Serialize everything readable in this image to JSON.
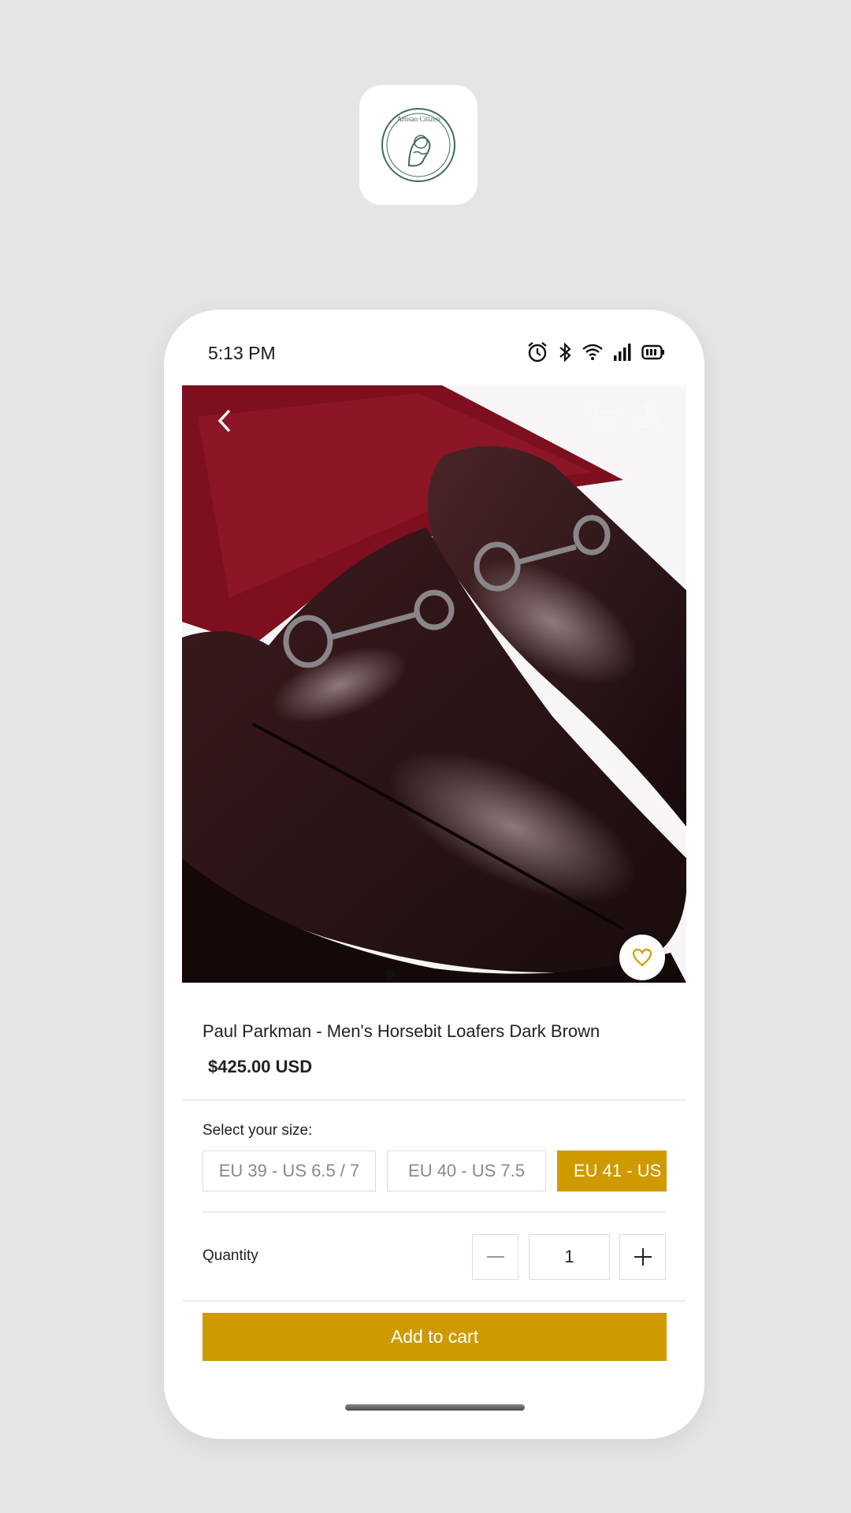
{
  "app_icon": {
    "brand_text": "Artisan Citizen",
    "icon": "artisan-citizen-logo"
  },
  "status_bar": {
    "time": "5:13 PM",
    "icons": [
      "alarm-icon",
      "bluetooth-icon",
      "wifi-icon",
      "signal-icon",
      "battery-icon"
    ]
  },
  "product": {
    "image_description_icon": "loafer-photo",
    "image_count": 1,
    "title": "Paul Parkman - Men's Horsebit Loafers Dark Brown",
    "price": "$425.00 USD"
  },
  "size": {
    "label": "Select your size:",
    "options": [
      {
        "label": "EU 39 - US 6.5 / 7",
        "selected": false
      },
      {
        "label": "EU 40 - US 7.5",
        "selected": false
      },
      {
        "label": "EU 41 - US",
        "selected": true
      }
    ]
  },
  "quantity": {
    "label": "Quantity",
    "value": "1",
    "minus": "–",
    "plus": "+"
  },
  "actions": {
    "add_to_cart": "Add to cart"
  },
  "colors": {
    "accent": "#cf9a00",
    "background": "#e5e5e5"
  }
}
